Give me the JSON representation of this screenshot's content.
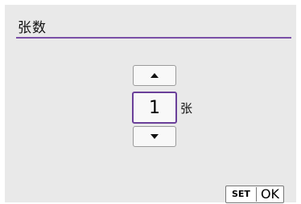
{
  "header": {
    "title": "张数"
  },
  "stepper": {
    "value": "1",
    "unit": "张",
    "up_icon": "triangle-up-icon",
    "down_icon": "triangle-down-icon"
  },
  "footer": {
    "set_label": "SET",
    "ok_label": "OK"
  },
  "colors": {
    "accent": "#6a3f99",
    "background": "#e9e9e9"
  }
}
